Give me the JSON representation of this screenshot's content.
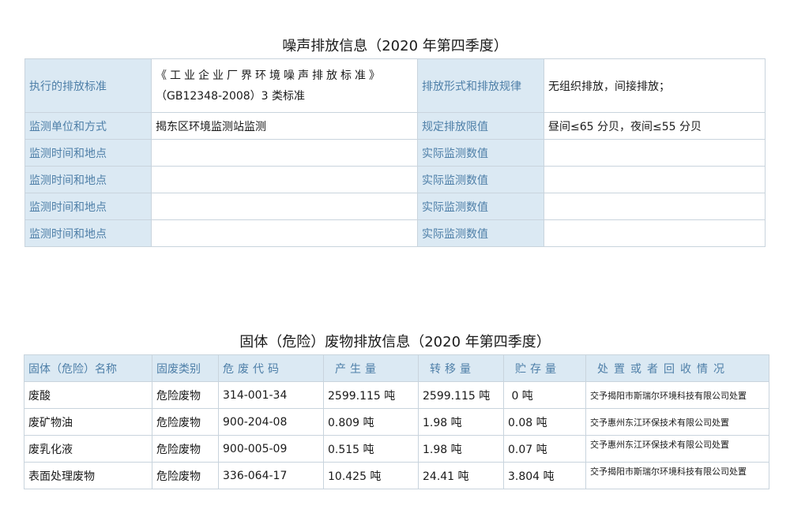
{
  "noise": {
    "title": "噪声排放信息（2020 年第四季度）",
    "row0": {
      "label1": "执行的排放标准",
      "standard_line1": "《工业企业厂界环境噪声排放标准》",
      "standard_line2": "（GB12348-2008）3 类标准",
      "label2": "排放形式和排放规律",
      "value2": "无组织排放，间接排放；"
    },
    "row1": {
      "label1": "监测单位和方式",
      "value1": "揭东区环境监测站监测",
      "label2": "规定排放限值",
      "value2": "昼间≤65 分贝，夜间≤55 分贝"
    },
    "monitor_rows": [
      {
        "label1": "监测时间和地点",
        "value1": "",
        "label2": "实际监测数值",
        "value2": ""
      },
      {
        "label1": "监测时间和地点",
        "value1": "",
        "label2": "实际监测数值",
        "value2": ""
      },
      {
        "label1": "监测时间和地点",
        "value1": "",
        "label2": "实际监测数值",
        "value2": ""
      },
      {
        "label1": "监测时间和地点",
        "value1": "",
        "label2": "实际监测数值",
        "value2": ""
      }
    ]
  },
  "waste": {
    "title": "固体（危险）废物排放信息（2020 年第四季度）",
    "headers": [
      "固体（危险）名称",
      "固废类别",
      "危废代码",
      "产生量",
      "转移量",
      "贮存量",
      "处置或者回收情况"
    ],
    "rows": [
      {
        "name": "废酸",
        "category": "危险废物",
        "code": "314-001-34",
        "produced": "2599.115 吨",
        "transferred": "2599.115 吨",
        "stored": " 0 吨",
        "disposal": "交予揭阳市斯瑞尔环境科技有限公司处置"
      },
      {
        "name": "废矿物油",
        "category": "危险废物",
        "code": "900-204-08",
        "produced": "0.809 吨",
        "transferred": "1.98 吨",
        "stored": "0.08 吨",
        "disposal": "交予惠州东江环保技术有限公司处置"
      },
      {
        "name": "废乳化液",
        "category": "危险废物",
        "code": "900-005-09",
        "produced": "0.515 吨",
        "transferred": "1.98 吨",
        "stored": "0.07 吨",
        "disposal": "交予惠州东江环保技术有限公司处置"
      },
      {
        "name": "表面处理废物",
        "category": "危险废物",
        "code": "336-064-17",
        "produced": "10.425 吨",
        "transferred": "24.41 吨",
        "stored": "3.804 吨",
        "disposal": "交予揭阳市斯瑞尔环境科技有限公司处置"
      }
    ]
  }
}
